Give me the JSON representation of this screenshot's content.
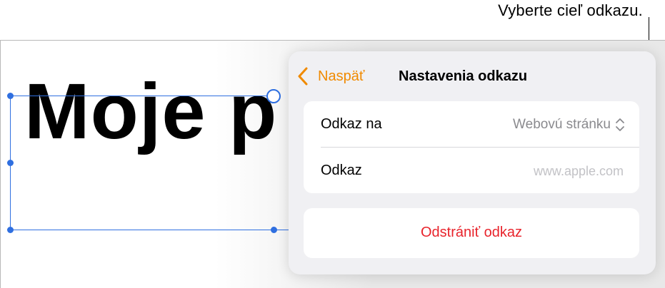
{
  "callout": {
    "text": "Vyberte cieľ odkazu."
  },
  "canvas": {
    "title_text": "Moje p"
  },
  "popover": {
    "back_label": "Naspäť",
    "title": "Nastavenia odkazu",
    "link_to": {
      "label": "Odkaz na",
      "value": "Webovú stránku"
    },
    "link": {
      "label": "Odkaz",
      "placeholder": "www.apple.com"
    },
    "remove_label": "Odstrániť odkaz",
    "accent_color": "#f08a00",
    "destructive_color": "#e8232b"
  },
  "icons": {
    "back": "chevron-left-icon",
    "picker": "chevron-up-down-icon"
  }
}
